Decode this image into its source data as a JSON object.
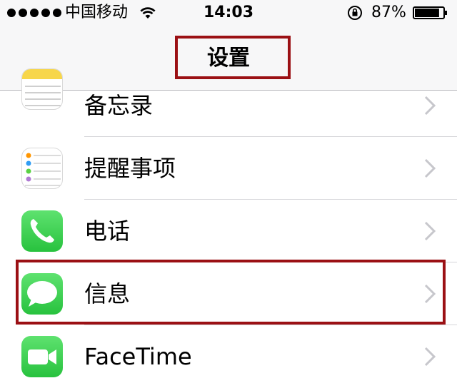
{
  "status_bar": {
    "carrier": "中国移动",
    "time": "14:03",
    "battery_percent": "87%",
    "battery_level": 0.87,
    "icons": [
      "signal-dots",
      "wifi-icon",
      "rotation-lock-icon",
      "battery-icon"
    ]
  },
  "nav": {
    "title": "设置"
  },
  "settings_list": [
    {
      "label": "备忘录",
      "icon": "notes-icon"
    },
    {
      "label": "提醒事项",
      "icon": "reminders-icon"
    },
    {
      "label": "电话",
      "icon": "phone-icon"
    },
    {
      "label": "信息",
      "icon": "messages-icon"
    },
    {
      "label": "FaceTime",
      "icon": "facetime-icon"
    }
  ],
  "colors": {
    "highlight_box": "#9b1014",
    "green_icon": "#3fd35a",
    "chevron": "#c7c7cc",
    "nav_background": "#f7f7f8"
  }
}
